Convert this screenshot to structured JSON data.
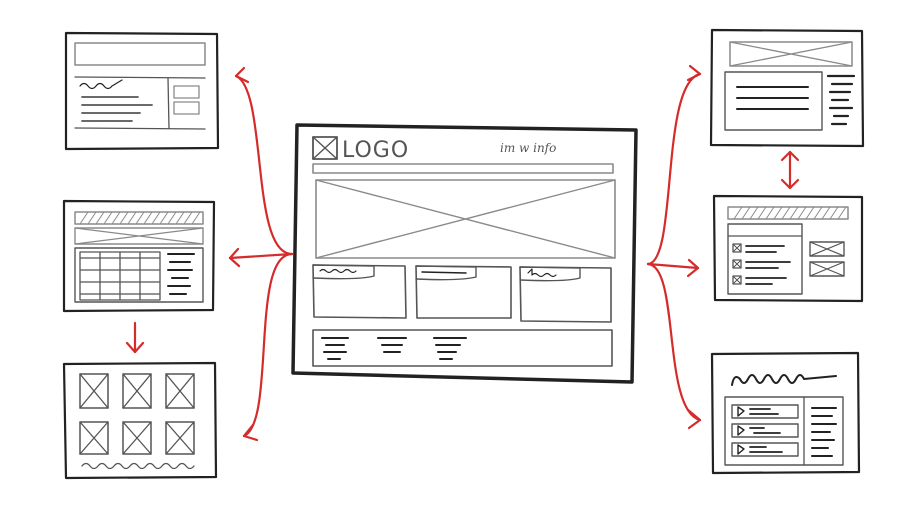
{
  "main_wireframe": {
    "logo_text": "LOGO",
    "nav_scribble": "im w info"
  },
  "colors": {
    "ink": "#222222",
    "pencil": "#8a8a8a",
    "arrow": "#d62b2b",
    "background": "#ffffff"
  },
  "icons": [
    "placeholder-image-icon",
    "checkbox-icon",
    "arrow-icon"
  ]
}
